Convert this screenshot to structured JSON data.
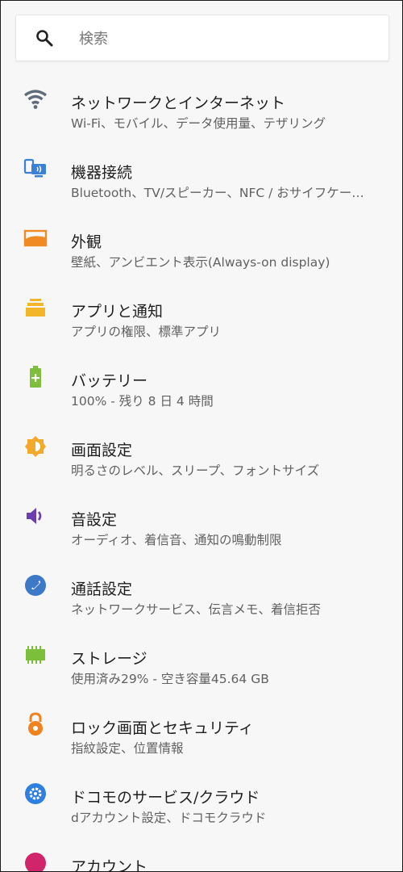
{
  "search": {
    "placeholder": "検索",
    "icon": "search-icon"
  },
  "colors": {
    "wifi": "#5f6b7a",
    "device": "#3b7fd6",
    "display": "#f08a24",
    "apps": "#f3b52a",
    "battery": "#7cbf3a",
    "brightness": "#f3a92a",
    "sound": "#6a3db0",
    "call": "#3d79c7",
    "storage": "#7cbf3a",
    "lock": "#f0821f",
    "docomo": "#2f7fe0",
    "account": "#d0246b"
  },
  "items": [
    {
      "title": "ネットワークとインターネット",
      "sub": "Wi-Fi、モバイル、データ使用量、テザリング",
      "icon": "wifi-icon"
    },
    {
      "title": "機器接続",
      "sub": "Bluetooth、TV/スピーカー、NFC / おサイフケー…",
      "icon": "connected-devices-icon"
    },
    {
      "title": "外観",
      "sub": "壁紙、アンビエント表示(Always-on display)",
      "icon": "wallpaper-icon"
    },
    {
      "title": "アプリと通知",
      "sub": "アプリの権限、標準アプリ",
      "icon": "apps-icon"
    },
    {
      "title": "バッテリー",
      "sub": "100% - 残り 8 日 4 時間",
      "icon": "battery-icon"
    },
    {
      "title": "画面設定",
      "sub": "明るさのレベル、スリープ、フォントサイズ",
      "icon": "brightness-icon"
    },
    {
      "title": "音設定",
      "sub": "オーディオ、着信音、通知の鳴動制限",
      "icon": "volume-icon"
    },
    {
      "title": "通話設定",
      "sub": "ネットワークサービス、伝言メモ、着信拒否",
      "icon": "phone-icon"
    },
    {
      "title": "ストレージ",
      "sub": "使用済み29% - 空き容量45.64 GB",
      "icon": "storage-icon"
    },
    {
      "title": "ロック画面とセキュリティ",
      "sub": "指紋設定、位置情報",
      "icon": "lock-icon"
    },
    {
      "title": "ドコモのサービス/クラウド",
      "sub": "dアカウント設定、ドコモクラウド",
      "icon": "docomo-settings-icon"
    },
    {
      "title": "アカウント",
      "sub": "",
      "icon": "account-icon"
    }
  ]
}
